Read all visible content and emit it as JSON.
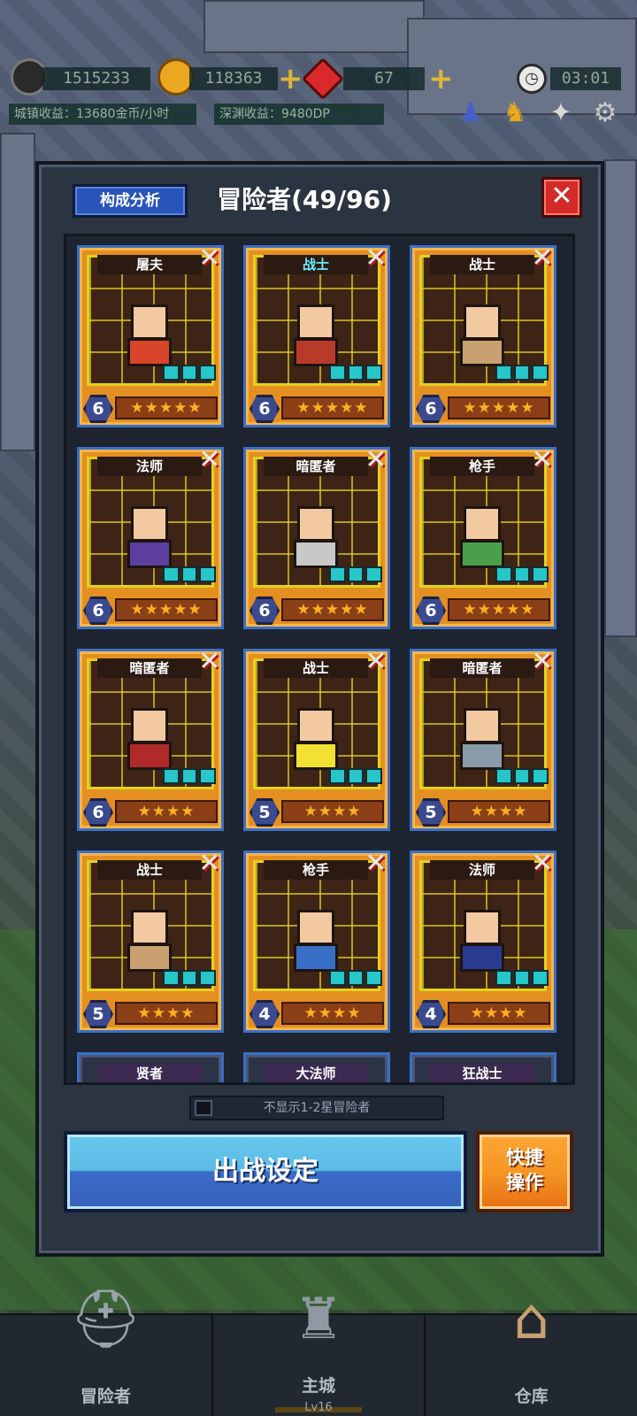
{
  "hud": {
    "soul": "1515233",
    "gold": "118363",
    "gem": "67",
    "timer": "03:01",
    "town_income": "城镇收益：13680金币/小时",
    "abyss_income": "深渊收益：9480DP"
  },
  "panel": {
    "analysis_label": "构成分析",
    "title": "冒险者(49/96)",
    "close_symbol": "✕"
  },
  "cards": [
    {
      "cls": "屠夫",
      "level": "6",
      "stars": "★★★★★",
      "highlight": false
    },
    {
      "cls": "战士",
      "level": "6",
      "stars": "★★★★★",
      "highlight": true
    },
    {
      "cls": "战士",
      "level": "6",
      "stars": "★★★★★",
      "highlight": false
    },
    {
      "cls": "法师",
      "level": "6",
      "stars": "★★★★★",
      "highlight": false
    },
    {
      "cls": "暗匿者",
      "level": "6",
      "stars": "★★★★★",
      "highlight": false
    },
    {
      "cls": "枪手",
      "level": "6",
      "stars": "★★★★★",
      "highlight": false
    },
    {
      "cls": "暗匿者",
      "level": "6",
      "stars": "★★★★",
      "highlight": false
    },
    {
      "cls": "战士",
      "level": "5",
      "stars": "★★★★",
      "highlight": false
    },
    {
      "cls": "暗匿者",
      "level": "5",
      "stars": "★★★★",
      "highlight": false
    },
    {
      "cls": "战士",
      "level": "5",
      "stars": "★★★★",
      "highlight": false
    },
    {
      "cls": "枪手",
      "level": "4",
      "stars": "★★★★",
      "highlight": false
    },
    {
      "cls": "法师",
      "level": "4",
      "stars": "★★★★",
      "highlight": false
    },
    {
      "cls": "贤者"
    },
    {
      "cls": "大法师"
    },
    {
      "cls": "狂战士"
    }
  ],
  "filter_label": "不显示1-2星冒险者",
  "battle_setting_label": "出战设定",
  "quick_line1": "快捷",
  "quick_line2": "操作",
  "nav": {
    "adventurer": "冒险者",
    "main_city": "主城",
    "main_city_level": "Lv16",
    "warehouse": "仓库"
  },
  "colors": {
    "card_orange": "#e48f22",
    "card_border_blue": "#3a6fc7",
    "star_color": "#ffb020",
    "battle_button_blue": "#5bbbe6",
    "quick_button_orange": "#f59624",
    "close_red": "#d42a2a"
  }
}
